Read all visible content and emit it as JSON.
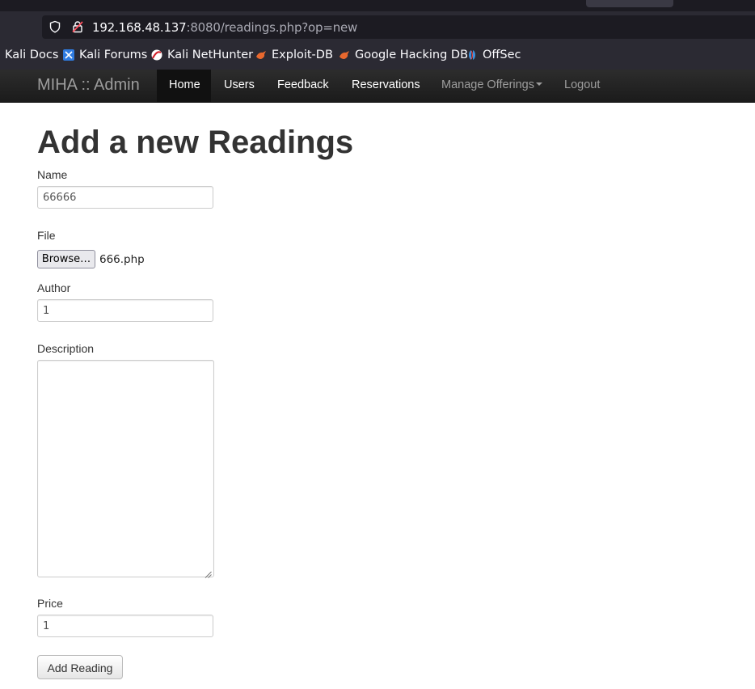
{
  "browser": {
    "url_host": "192.168.48.137",
    "url_rest": ":8080/readings.php?op=new",
    "bookmarks": [
      {
        "label": "Kali Docs",
        "icon": "kali-docs-icon"
      },
      {
        "label": "Kali Forums",
        "icon": "kali-forums-icon"
      },
      {
        "label": "Kali NetHunter",
        "icon": "kali-nethunter-icon"
      },
      {
        "label": "Exploit-DB",
        "icon": "exploit-db-icon"
      },
      {
        "label": "Google Hacking DB",
        "icon": "google-hacking-db-icon"
      },
      {
        "label": "OffSec",
        "icon": "offsec-icon"
      }
    ]
  },
  "navbar": {
    "brand": "MIHA :: Admin",
    "links": [
      "Home",
      "Users",
      "Feedback",
      "Reservations",
      "Manage Offerings",
      "Logout"
    ],
    "active": "Home"
  },
  "form": {
    "title": "Add a new Readings",
    "name_label": "Name",
    "name_value": "66666",
    "file_label": "File",
    "browse_label": "Browse…",
    "file_name": "666.php",
    "author_label": "Author",
    "author_value": "1",
    "description_label": "Description",
    "description_value": "",
    "price_label": "Price",
    "price_value": "1",
    "submit_label": "Add Reading"
  }
}
